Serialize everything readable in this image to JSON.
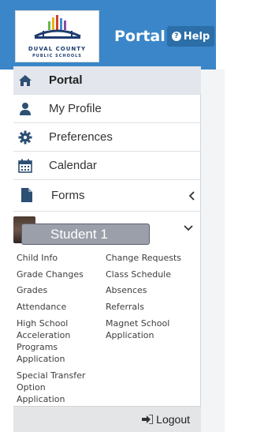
{
  "header": {
    "logo_line1": "DUVAL COUNTY",
    "logo_line2": "PUBLIC SCHOOLS",
    "title": "Portal",
    "help_label": "Help",
    "help_glyph": "?"
  },
  "sidebar": {
    "items": [
      {
        "label": "Portal",
        "icon": "home-icon",
        "active": true
      },
      {
        "label": "My Profile",
        "icon": "user-icon"
      },
      {
        "label": "Preferences",
        "icon": "gear-icon"
      },
      {
        "label": "Calendar",
        "icon": "calendar-icon"
      },
      {
        "label": "Forms",
        "icon": "file-icon"
      }
    ],
    "student_name": "Student 1",
    "links_left": [
      "Child Info",
      "Grade Changes",
      "Grades",
      "Attendance",
      "High School",
      "Acceleration",
      "Programs",
      "Application",
      "Special Transfer",
      "Option",
      "Application"
    ],
    "links_right": [
      "Change Requests",
      "Class Schedule",
      "Absences",
      "Referrals",
      "Magnet School",
      "Application"
    ],
    "logout_label": "Logout"
  },
  "colors": {
    "header_bg": "#3a86c8",
    "help_bg": "#2b6ea8",
    "active_bg": "#e4e6ee",
    "icon_color": "#2d4f73"
  }
}
